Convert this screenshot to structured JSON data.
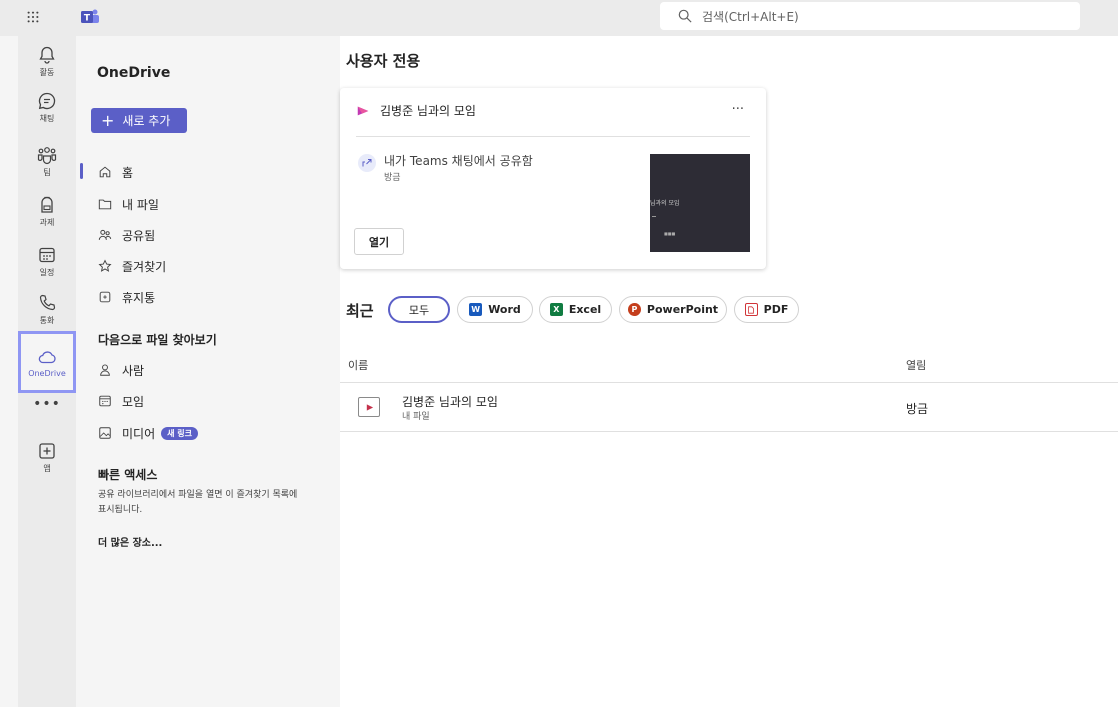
{
  "topbar": {
    "search_placeholder": "검색(Ctrl+Alt+E)"
  },
  "rail": {
    "items": [
      {
        "label": "활동"
      },
      {
        "label": "채팅"
      },
      {
        "label": "팀"
      },
      {
        "label": "과제"
      },
      {
        "label": "일정"
      },
      {
        "label": "통화"
      },
      {
        "label": "OneDrive"
      },
      {
        "label": "앱"
      }
    ],
    "more": "•••"
  },
  "leftnav": {
    "title": "OneDrive",
    "add_button": "새로 추가",
    "items": [
      {
        "label": "홈"
      },
      {
        "label": "내 파일"
      },
      {
        "label": "공유됨"
      },
      {
        "label": "즐겨찾기"
      },
      {
        "label": "휴지통"
      }
    ],
    "browse_header": "다음으로 파일 찾아보기",
    "browse_items": [
      {
        "label": "사람"
      },
      {
        "label": "모임"
      },
      {
        "label": "미디어",
        "badge": "새 링크"
      }
    ],
    "quick_access_header": "빠른 액세스",
    "quick_access_desc": "공유 라이브러리에서 파일을 열면 이 즐겨찾기 목록에 표시됩니다.",
    "more_places": "더 많은 장소..."
  },
  "main": {
    "title": "사용자 전용",
    "card": {
      "title": "김병준 님과의 모임",
      "more": "···",
      "share_text": "내가 Teams 채팅에서 공유함",
      "share_time": "방금",
      "open_button": "열기",
      "thumb_title": "님과의 모임"
    },
    "recent_label": "최근",
    "filters": [
      {
        "label": "모두"
      },
      {
        "label": "Word"
      },
      {
        "label": "Excel"
      },
      {
        "label": "PowerPoint"
      },
      {
        "label": "PDF"
      }
    ],
    "table": {
      "col_name": "이름",
      "col_opened": "열림",
      "rows": [
        {
          "name": "김병준 님과의 모임",
          "location": "내 파일",
          "opened": "방금"
        }
      ]
    }
  },
  "colors": {
    "accent": "#5b5fc7",
    "highlight": "#8f96f3",
    "word": "#185abd",
    "excel": "#107c41",
    "powerpoint": "#c43e1c",
    "pdf": "#d13438"
  }
}
